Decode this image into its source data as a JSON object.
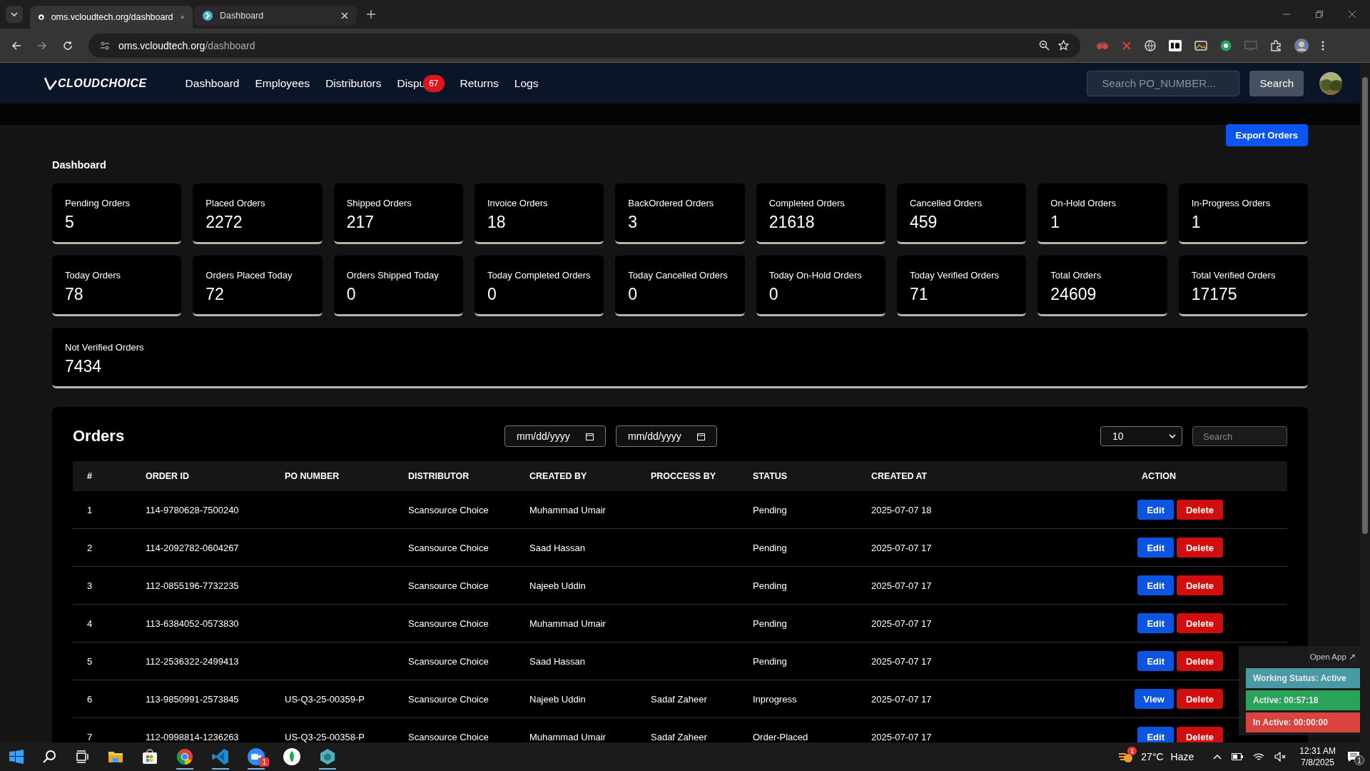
{
  "browser": {
    "tabs": [
      {
        "title": "oms.vcloudtech.org/dashboard",
        "selected": true
      },
      {
        "title": "Dashboard",
        "selected": false
      }
    ],
    "address": {
      "host": "oms.vcloudtech.org",
      "path": "/dashboard"
    }
  },
  "navbar": {
    "logo": "CLOUDCHOICE",
    "links": [
      {
        "label": "Dashboard"
      },
      {
        "label": "Employees"
      },
      {
        "label": "Distributors"
      },
      {
        "label": "Dispu",
        "badge": "67"
      },
      {
        "label": "Returns"
      },
      {
        "label": "Logs"
      }
    ],
    "search": {
      "placeholder": "Search PO_NUMBER..."
    },
    "search_button": "Search"
  },
  "export_button": "Export Orders",
  "heading": "Dashboard",
  "stats": [
    {
      "label": "Pending Orders",
      "value": "5"
    },
    {
      "label": "Placed Orders",
      "value": "2272"
    },
    {
      "label": "Shipped Orders",
      "value": "217"
    },
    {
      "label": "Invoice Orders",
      "value": "18"
    },
    {
      "label": "BackOrdered Orders",
      "value": "3"
    },
    {
      "label": "Completed Orders",
      "value": "21618"
    },
    {
      "label": "Cancelled Orders",
      "value": "459"
    },
    {
      "label": "On-Hold Orders",
      "value": "1"
    },
    {
      "label": "In-Progress Orders",
      "value": "1"
    },
    {
      "label": "Today Orders",
      "value": "78"
    },
    {
      "label": "Orders Placed Today",
      "value": "72"
    },
    {
      "label": "Orders Shipped Today",
      "value": "0"
    },
    {
      "label": "Today Completed Orders",
      "value": "0"
    },
    {
      "label": "Today Cancelled Orders",
      "value": "0"
    },
    {
      "label": "Today On-Hold Orders",
      "value": "0"
    },
    {
      "label": "Today Verified Orders",
      "value": "71"
    },
    {
      "label": "Total Orders",
      "value": "24609"
    },
    {
      "label": "Total Verified Orders",
      "value": "17175"
    },
    {
      "label": "Not Verified Orders",
      "value": "7434",
      "wide": true
    }
  ],
  "orders": {
    "title": "Orders",
    "date_from": "mm/dd/yyyy",
    "date_to": "mm/dd/yyyy",
    "page_size": "10",
    "search": {
      "placeholder": "Search"
    },
    "columns": [
      "#",
      "ORDER ID",
      "PO NUMBER",
      "DISTRIBUTOR",
      "CREATED BY",
      "PROCCESS BY",
      "STATUS",
      "CREATED AT",
      "ACTION"
    ],
    "rows": [
      {
        "num": "1",
        "order_id": "114-9780628-7500240",
        "distributor": "Scansource Choice",
        "created_by": "Muhammad Umair",
        "status": "Pending",
        "created_at": "2025-07-07 18",
        "actions": [
          {
            "label": "Edit",
            "kind": "primary"
          },
          {
            "label": "Delete",
            "kind": "danger"
          }
        ]
      },
      {
        "num": "2",
        "order_id": "114-2092782-0604267",
        "distributor": "Scansource Choice",
        "created_by": "Saad Hassan",
        "status": "Pending",
        "created_at": "2025-07-07 17",
        "actions": [
          {
            "label": "Edit",
            "kind": "primary"
          },
          {
            "label": "Delete",
            "kind": "danger"
          }
        ]
      },
      {
        "num": "3",
        "order_id": "112-0855196-7732235",
        "distributor": "Scansource Choice",
        "created_by": "Najeeb Uddin",
        "status": "Pending",
        "created_at": "2025-07-07 17",
        "actions": [
          {
            "label": "Edit",
            "kind": "primary"
          },
          {
            "label": "Delete",
            "kind": "danger"
          }
        ]
      },
      {
        "num": "4",
        "order_id": "113-6384052-0573830",
        "distributor": "Scansource Choice",
        "created_by": "Muhammad Umair",
        "status": "Pending",
        "created_at": "2025-07-07 17",
        "actions": [
          {
            "label": "Edit",
            "kind": "primary"
          },
          {
            "label": "Delete",
            "kind": "danger"
          }
        ]
      },
      {
        "num": "5",
        "order_id": "112-2536322-2499413",
        "distributor": "Scansource Choice",
        "created_by": "Saad Hassan",
        "status": "Pending",
        "created_at": "2025-07-07 17",
        "actions": [
          {
            "label": "Edit",
            "kind": "primary"
          },
          {
            "label": "Delete",
            "kind": "danger"
          }
        ]
      },
      {
        "num": "6",
        "order_id": "113-9850991-2573845",
        "po_number": "US-Q3-25-00359-P",
        "distributor": "Scansource Choice",
        "created_by": "Najeeb Uddin",
        "process_by": "Sadaf Zaheer",
        "status": "Inprogress",
        "created_at": "2025-07-07 17",
        "actions": [
          {
            "label": "View",
            "kind": "primary"
          },
          {
            "label": "Delete",
            "kind": "danger"
          }
        ]
      },
      {
        "num": "7",
        "order_id": "112-0998814-1236263",
        "po_number": "US-Q3-25-00358-P",
        "distributor": "Scansource Choice",
        "created_by": "Muhammad Umair",
        "process_by": "Sadaf Zaheer",
        "status": "Order-Placed",
        "created_at": "2025-07-07 17",
        "actions": [
          {
            "label": "Edit",
            "kind": "primary"
          },
          {
            "label": "Delete",
            "kind": "danger"
          }
        ]
      }
    ]
  },
  "tracker": {
    "open_app": "Open App ↗",
    "items": [
      {
        "text": "Working Status: Active",
        "color": "#4a9aa5"
      },
      {
        "text": "Active: 00:57:18",
        "color": "#2aa35a"
      },
      {
        "text": "In Active: 00:00:00",
        "color": "#d9443f"
      }
    ]
  },
  "taskbar": {
    "zoom_badge": "1",
    "weather": {
      "badge": "1",
      "temp": "27°C",
      "condition": "Haze"
    },
    "time": "12:31 AM",
    "date": "7/8/2025",
    "notifications": "1"
  }
}
